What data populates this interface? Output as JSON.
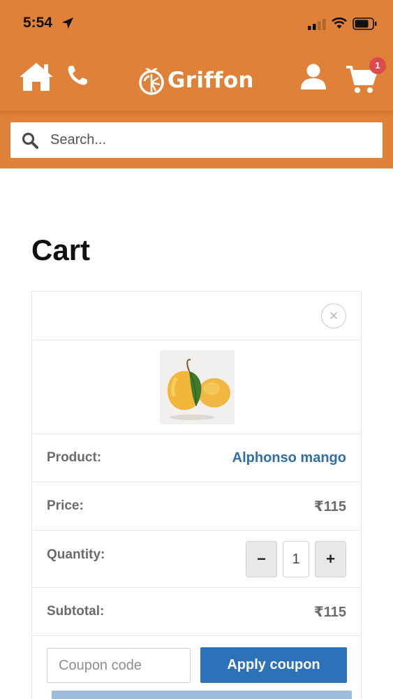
{
  "status_bar": {
    "time": "5:54"
  },
  "header": {
    "brand": "Griffon",
    "cart_count": "1",
    "colors": {
      "header_bg": "#e0813a",
      "badge": "#d94a4a"
    }
  },
  "search": {
    "placeholder": "Search..."
  },
  "page": {
    "title": "Cart"
  },
  "cart": {
    "remove_symbol": "×",
    "product_label": "Product:",
    "product_name": "Alphonso mango",
    "price_label": "Price:",
    "price_value": "₹115",
    "quantity_label": "Quantity:",
    "quantity_value": "1",
    "minus_symbol": "−",
    "plus_symbol": "+",
    "subtotal_label": "Subtotal:",
    "subtotal_value": "₹115",
    "coupon_placeholder": "Coupon code",
    "apply_coupon_label": "Apply coupon"
  },
  "colors": {
    "link": "#2f6fa8",
    "primary_button": "#2c72b8"
  }
}
